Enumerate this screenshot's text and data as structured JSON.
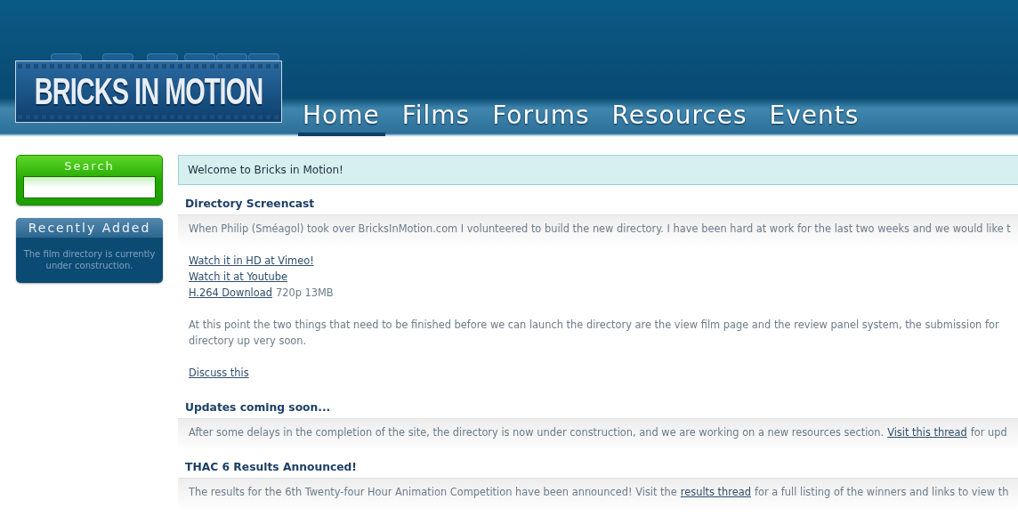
{
  "header": {
    "logo": {
      "text": "BRICKS IN MOTION"
    },
    "nav": [
      {
        "label": "Home",
        "selected": true
      },
      {
        "label": "Films",
        "selected": false
      },
      {
        "label": "Forums",
        "selected": false
      },
      {
        "label": "Resources",
        "selected": false
      },
      {
        "label": "Events",
        "selected": false
      }
    ]
  },
  "sidebar": {
    "search": {
      "title": "Search"
    },
    "recently_added": {
      "title": "Recently Added",
      "text": "The film directory is currently under construction."
    }
  },
  "main": {
    "welcome": "Welcome to Bricks in Motion!",
    "posts": [
      {
        "title": "Directory Screencast",
        "blocks": [
          [
            [
              {
                "kind": "text",
                "text": "When Philip (Sméagol) took over BricksInMotion.com I volunteered to build the new directory. I have been hard at work for the last two weeks and we would like t"
              }
            ]
          ],
          [
            [
              {
                "kind": "link",
                "text": "Watch it in HD at Vimeo!"
              }
            ],
            [
              {
                "kind": "link",
                "text": "Watch it at Youtube"
              }
            ],
            [
              {
                "kind": "link",
                "text": "H.264 Download"
              },
              {
                "kind": "text",
                "text": "720p 13MB"
              }
            ]
          ],
          [
            [
              {
                "kind": "text",
                "text": "At this point the two things that need to be finished before we can launch the directory are the view film page and the review panel system, the submission for"
              }
            ],
            [
              {
                "kind": "text",
                "text": "directory up very soon."
              }
            ]
          ],
          [
            [
              {
                "kind": "link",
                "text": "Discuss this"
              }
            ]
          ]
        ]
      },
      {
        "title": "Updates coming soon...",
        "blocks": [
          [
            [
              {
                "kind": "text",
                "text": "After some delays in the completion of the site, the directory is now under construction, and we are working on a new resources section."
              },
              {
                "kind": "link",
                "text": "Visit this thread"
              },
              {
                "kind": "text",
                "text": "for upd"
              }
            ]
          ]
        ]
      },
      {
        "title": "THAC 6 Results Announced!",
        "blocks": [
          [
            [
              {
                "kind": "text",
                "text": "The results for the 6th Twenty-four Hour Animation Competition have been announced! Visit the"
              },
              {
                "kind": "link",
                "text": "results thread"
              },
              {
                "kind": "text",
                "text": "for a full listing of the winners and links to view th"
              }
            ]
          ]
        ]
      }
    ]
  }
}
